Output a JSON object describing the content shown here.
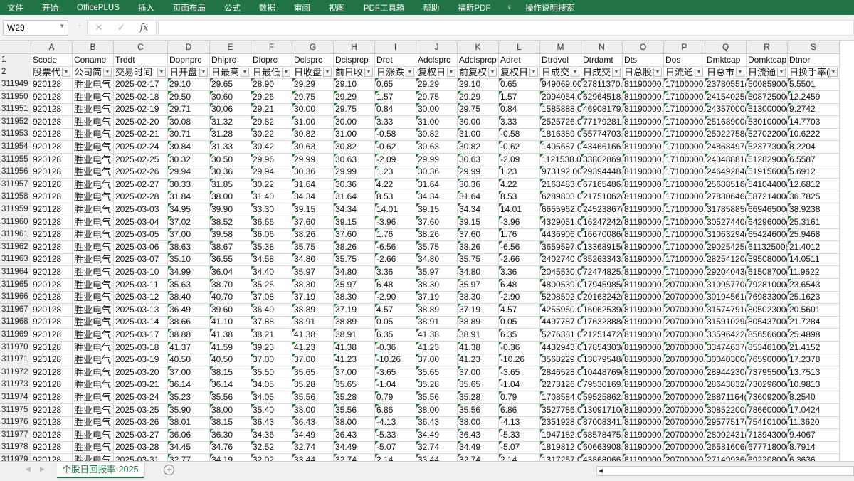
{
  "ribbon": {
    "tabs": [
      "文件",
      "开始",
      "OfficePLUS",
      "插入",
      "页面布局",
      "公式",
      "数据",
      "审阅",
      "视图",
      "PDF工具箱",
      "帮助",
      "福昕PDF"
    ],
    "search": "操作说明搜索"
  },
  "formula_bar": {
    "name_box": "W29",
    "cancel": "✕",
    "enter": "✓",
    "fx": "fx",
    "value": ""
  },
  "columns": [
    "A",
    "B",
    "C",
    "D",
    "E",
    "F",
    "G",
    "H",
    "I",
    "J",
    "K",
    "L",
    "M",
    "N",
    "O",
    "P",
    "Q",
    "R",
    "S"
  ],
  "header_row_num": "1",
  "header_row": [
    "Scode",
    "Coname",
    "Trddt",
    "Dopnprc",
    "Dhiprc",
    "Dloprc",
    "Dclsprc",
    "Dclsprcp",
    "Dret",
    "Adclsprc",
    "Adclsprcp",
    "Adret",
    "Dtrdvol",
    "Dtrdamt",
    "Dts",
    "Dos",
    "Dmktcap",
    "Domktcap",
    "Dtnor"
  ],
  "label_row_num": "2",
  "label_row": [
    "股票代",
    "公司简",
    "交易时间",
    "日开盘",
    "日最高",
    "日最低",
    "日收盘",
    "前日收",
    "日涨跌",
    "复权日",
    "前复权",
    "复权日",
    "日成交",
    "日成交",
    "日总股",
    "日流通",
    "日总市",
    "日流通",
    "日换手率("
  ],
  "rows": [
    {
      "n": "311949",
      "c": [
        "920128",
        "胜业电气",
        "2025-02-17",
        "29.10",
        "29.65",
        "28.90",
        "29.29",
        "29.10",
        "0.65",
        "29.29",
        "29.10",
        "0.65",
        "949069.00",
        "27811370.",
        "81190000.",
        "17100000.",
        "23780551(",
        "50085900(",
        "5.5501"
      ]
    },
    {
      "n": "311950",
      "c": [
        "920128",
        "胜业电气",
        "2025-02-18",
        "29.50",
        "30.60",
        "29.26",
        "29.75",
        "29.29",
        "1.57",
        "29.75",
        "29.29",
        "1.57",
        "2094054.0",
        "62964518.",
        "81190000.",
        "17100000.",
        "24154025(",
        "50872500(",
        "12.2459"
      ]
    },
    {
      "n": "311951",
      "c": [
        "920128",
        "胜业电气",
        "2025-02-19",
        "29.71",
        "30.06",
        "29.21",
        "30.00",
        "29.75",
        "0.84",
        "30.00",
        "29.75",
        "0.84",
        "1585888.0",
        "46908179.",
        "81190000.",
        "17100000.",
        "24357000(",
        "51300000(",
        "9.2742"
      ]
    },
    {
      "n": "311952",
      "c": [
        "920128",
        "胜业电气",
        "2025-02-20",
        "30.08",
        "31.32",
        "29.82",
        "31.00",
        "30.00",
        "3.33",
        "31.00",
        "30.00",
        "3.33",
        "2525726.0",
        "77179281.",
        "81190000.",
        "17100000.",
        "25168900(",
        "53010000(",
        "14.7703"
      ]
    },
    {
      "n": "311953",
      "c": [
        "920128",
        "胜业电气",
        "2025-02-21",
        "30.71",
        "31.28",
        "30.22",
        "30.82",
        "31.00",
        "-0.58",
        "30.82",
        "31.00",
        "-0.58",
        "1816389.0",
        "55774703.",
        "81190000.",
        "17100000.",
        "25022758(",
        "52702200(",
        "10.6222"
      ]
    },
    {
      "n": "311954",
      "c": [
        "920128",
        "胜业电气",
        "2025-02-24",
        "30.84",
        "31.33",
        "30.42",
        "30.63",
        "30.82",
        "-0.62",
        "30.63",
        "30.82",
        "-0.62",
        "1405687.0",
        "43466166.",
        "81190000.",
        "17100000.",
        "24868497(",
        "52377300(",
        "8.2204"
      ]
    },
    {
      "n": "311955",
      "c": [
        "920128",
        "胜业电气",
        "2025-02-25",
        "30.32",
        "30.50",
        "29.96",
        "29.99",
        "30.63",
        "-2.09",
        "29.99",
        "30.63",
        "-2.09",
        "1121538.0",
        "33802869.",
        "81190000.",
        "17100000.",
        "24348881(",
        "51282900(",
        "6.5587"
      ]
    },
    {
      "n": "311956",
      "c": [
        "920128",
        "胜业电气",
        "2025-02-26",
        "29.94",
        "30.36",
        "29.94",
        "30.36",
        "29.99",
        "1.23",
        "30.36",
        "29.99",
        "1.23",
        "973192.00",
        "29394448.",
        "81190000.",
        "17100000.",
        "24649284(",
        "51915600(",
        "5.6912"
      ]
    },
    {
      "n": "311957",
      "c": [
        "920128",
        "胜业电气",
        "2025-02-27",
        "30.33",
        "31.85",
        "30.22",
        "31.64",
        "30.36",
        "4.22",
        "31.64",
        "30.36",
        "4.22",
        "2168483.0",
        "67165486.",
        "81190000.",
        "17100000.",
        "25688516(",
        "54104400(",
        "12.6812"
      ]
    },
    {
      "n": "311958",
      "c": [
        "920128",
        "胜业电气",
        "2025-02-28",
        "31.84",
        "38.00",
        "31.40",
        "34.34",
        "31.64",
        "8.53",
        "34.34",
        "31.64",
        "8.53",
        "6289803.0",
        "21751062(",
        "81190000.",
        "17100000.",
        "27880646(",
        "58721400(",
        "36.7825"
      ]
    },
    {
      "n": "311959",
      "c": [
        "920128",
        "胜业电气",
        "2025-03-03",
        "34.95",
        "39.90",
        "33.30",
        "39.15",
        "34.34",
        "14.01",
        "39.15",
        "34.34",
        "14.01",
        "6655962.0",
        "24523867(",
        "81190000.",
        "17100000.",
        "31785885(",
        "66946500(",
        "38.9238"
      ]
    },
    {
      "n": "311960",
      "c": [
        "920128",
        "胜业电气",
        "2025-03-04",
        "37.02",
        "38.52",
        "36.66",
        "37.60",
        "39.15",
        "-3.96",
        "37.60",
        "39.15",
        "-3.96",
        "4329051.0",
        "16247242(",
        "81190000.",
        "17100000.",
        "30527440(",
        "64296000(",
        "25.3161"
      ]
    },
    {
      "n": "311961",
      "c": [
        "920128",
        "胜业电气",
        "2025-03-05",
        "37.00",
        "39.58",
        "36.06",
        "38.26",
        "37.60",
        "1.76",
        "38.26",
        "37.60",
        "1.76",
        "4436906.0",
        "16670086(",
        "81190000.",
        "17100000.",
        "31063294(",
        "65424600(",
        "25.9468"
      ]
    },
    {
      "n": "311962",
      "c": [
        "920128",
        "胜业电气",
        "2025-03-06",
        "38.63",
        "38.67",
        "35.38",
        "35.75",
        "38.26",
        "-6.56",
        "35.75",
        "38.26",
        "-6.56",
        "3659597.0",
        "13368915(",
        "81190000.",
        "17100000.",
        "29025425(",
        "61132500(",
        "21.4012"
      ]
    },
    {
      "n": "311963",
      "c": [
        "920128",
        "胜业电气",
        "2025-03-07",
        "35.10",
        "36.55",
        "34.58",
        "34.80",
        "35.75",
        "-2.66",
        "34.80",
        "35.75",
        "-2.66",
        "2402740.0",
        "85263343.",
        "81190000.",
        "17100000.",
        "28254120(",
        "59508000(",
        "14.0511"
      ]
    },
    {
      "n": "311964",
      "c": [
        "920128",
        "胜业电气",
        "2025-03-10",
        "34.99",
        "36.04",
        "34.40",
        "35.97",
        "34.80",
        "3.36",
        "35.97",
        "34.80",
        "3.36",
        "2045530.0",
        "72474825.",
        "81190000.",
        "17100000.",
        "29204043(",
        "61508700(",
        "11.9622"
      ]
    },
    {
      "n": "311965",
      "c": [
        "920128",
        "胜业电气",
        "2025-03-11",
        "35.63",
        "38.70",
        "35.25",
        "38.30",
        "35.97",
        "6.48",
        "38.30",
        "35.97",
        "6.48",
        "4800539.0",
        "17945985(",
        "81190000.",
        "20700000.",
        "31095770(",
        "79281000(",
        "23.6543"
      ]
    },
    {
      "n": "311966",
      "c": [
        "920128",
        "胜业电气",
        "2025-03-12",
        "38.40",
        "40.70",
        "37.08",
        "37.19",
        "38.30",
        "-2.90",
        "37.19",
        "38.30",
        "-2.90",
        "5208592.0",
        "20163242(",
        "81190000.",
        "20700000.",
        "30194561(",
        "76983300(",
        "25.1623"
      ]
    },
    {
      "n": "311967",
      "c": [
        "920128",
        "胜业电气",
        "2025-03-13",
        "36.49",
        "39.60",
        "36.40",
        "38.89",
        "37.19",
        "4.57",
        "38.89",
        "37.19",
        "4.57",
        "4255950.0",
        "16062539(",
        "81190000.",
        "20700000.",
        "31574791(",
        "80502300(",
        "20.5601"
      ]
    },
    {
      "n": "311968",
      "c": [
        "920128",
        "胜业电气",
        "2025-03-14",
        "38.66",
        "41.10",
        "37.88",
        "38.91",
        "38.89",
        "0.05",
        "38.91",
        "38.89",
        "0.05",
        "4497787.0",
        "17632388(",
        "81190000.",
        "20700000.",
        "31591029(",
        "80543700(",
        "21.7284"
      ]
    },
    {
      "n": "311969",
      "c": [
        "920128",
        "胜业电气",
        "2025-03-17",
        "38.88",
        "41.38",
        "38.21",
        "41.38",
        "38.91",
        "6.35",
        "41.38",
        "38.91",
        "6.35",
        "5276381.0",
        "21251472(",
        "81190000.",
        "20700000.",
        "33596422(",
        "85656600(",
        "25.4898"
      ]
    },
    {
      "n": "311970",
      "c": [
        "920128",
        "胜业电气",
        "2025-03-18",
        "41.37",
        "41.59",
        "39.23",
        "41.23",
        "41.38",
        "-0.36",
        "41.23",
        "41.38",
        "-0.36",
        "4432943.0",
        "17854303(",
        "81190000.",
        "20700000.",
        "33474637(",
        "85346100(",
        "21.4152"
      ]
    },
    {
      "n": "311971",
      "c": [
        "920128",
        "胜业电气",
        "2025-03-19",
        "40.50",
        "40.50",
        "37.00",
        "37.00",
        "41.23",
        "-10.26",
        "37.00",
        "41.23",
        "-10.26",
        "3568229.0",
        "13879548(",
        "81190000.",
        "20700000.",
        "30040300(",
        "76590000(",
        "17.2378"
      ]
    },
    {
      "n": "311972",
      "c": [
        "920128",
        "胜业电气",
        "2025-03-20",
        "37.00",
        "38.15",
        "35.50",
        "35.65",
        "37.00",
        "-3.65",
        "35.65",
        "37.00",
        "-3.65",
        "2846528.0",
        "10448769(",
        "81190000.",
        "20700000.",
        "28944230(",
        "73795500(",
        "13.7513"
      ]
    },
    {
      "n": "311973",
      "c": [
        "920128",
        "胜业电气",
        "2025-03-21",
        "36.14",
        "36.14",
        "34.05",
        "35.28",
        "35.65",
        "-1.04",
        "35.28",
        "35.65",
        "-1.04",
        "2273126.0",
        "79530169.",
        "81190000.",
        "20700000.",
        "28643832(",
        "73029600(",
        "10.9813"
      ]
    },
    {
      "n": "311974",
      "c": [
        "920128",
        "胜业电气",
        "2025-03-24",
        "35.23",
        "35.56",
        "34.05",
        "35.56",
        "35.28",
        "0.79",
        "35.56",
        "35.28",
        "0.79",
        "1708584.0",
        "59525862.",
        "81190000.",
        "20700000.",
        "28871164(",
        "73609200(",
        "8.2540"
      ]
    },
    {
      "n": "311975",
      "c": [
        "920128",
        "胜业电气",
        "2025-03-25",
        "35.90",
        "38.00",
        "35.40",
        "38.00",
        "35.56",
        "6.86",
        "38.00",
        "35.56",
        "6.86",
        "3527786.0",
        "13091710(",
        "81190000.",
        "20700000.",
        "30852200(",
        "78660000(",
        "17.0424"
      ]
    },
    {
      "n": "311976",
      "c": [
        "920128",
        "胜业电气",
        "2025-03-26",
        "38.01",
        "38.15",
        "36.43",
        "36.43",
        "38.00",
        "-4.13",
        "36.43",
        "38.00",
        "-4.13",
        "2351928.0",
        "87008341.",
        "81190000.",
        "20700000.",
        "29577517(",
        "75410100(",
        "11.3620"
      ]
    },
    {
      "n": "311977",
      "c": [
        "920128",
        "胜业电气",
        "2025-03-27",
        "36.06",
        "36.30",
        "34.36",
        "34.49",
        "36.43",
        "-5.33",
        "34.49",
        "36.43",
        "-5.33",
        "1947182.0",
        "68578475.",
        "81190000.",
        "20700000.",
        "28002431(",
        "71394300(",
        "9.4067"
      ]
    },
    {
      "n": "311978",
      "c": [
        "920128",
        "胜业电气",
        "2025-03-28",
        "34.45",
        "34.76",
        "32.52",
        "32.74",
        "34.49",
        "-5.07",
        "32.74",
        "34.49",
        "-5.07",
        "1819812.0",
        "60663908.",
        "81190000.",
        "20700000.",
        "26581606(",
        "67771800(",
        "8.7914"
      ]
    },
    {
      "n": "311979",
      "c": [
        "920128",
        "胜业电气",
        "2025-03-31",
        "32.77",
        "34.19",
        "32.02",
        "33.44",
        "32.74",
        "2.14",
        "33.44",
        "32.74",
        "2.14",
        "1317257.0",
        "43868066.",
        "81190000.",
        "20700000.",
        "27149936(",
        "69220800(",
        "6.3636"
      ]
    }
  ],
  "sheet_tabs": {
    "active": "个股日回报率-2025",
    "add": "+"
  },
  "colors": {
    "accent": "#217346",
    "error_triangle": "#1e7a2e"
  }
}
